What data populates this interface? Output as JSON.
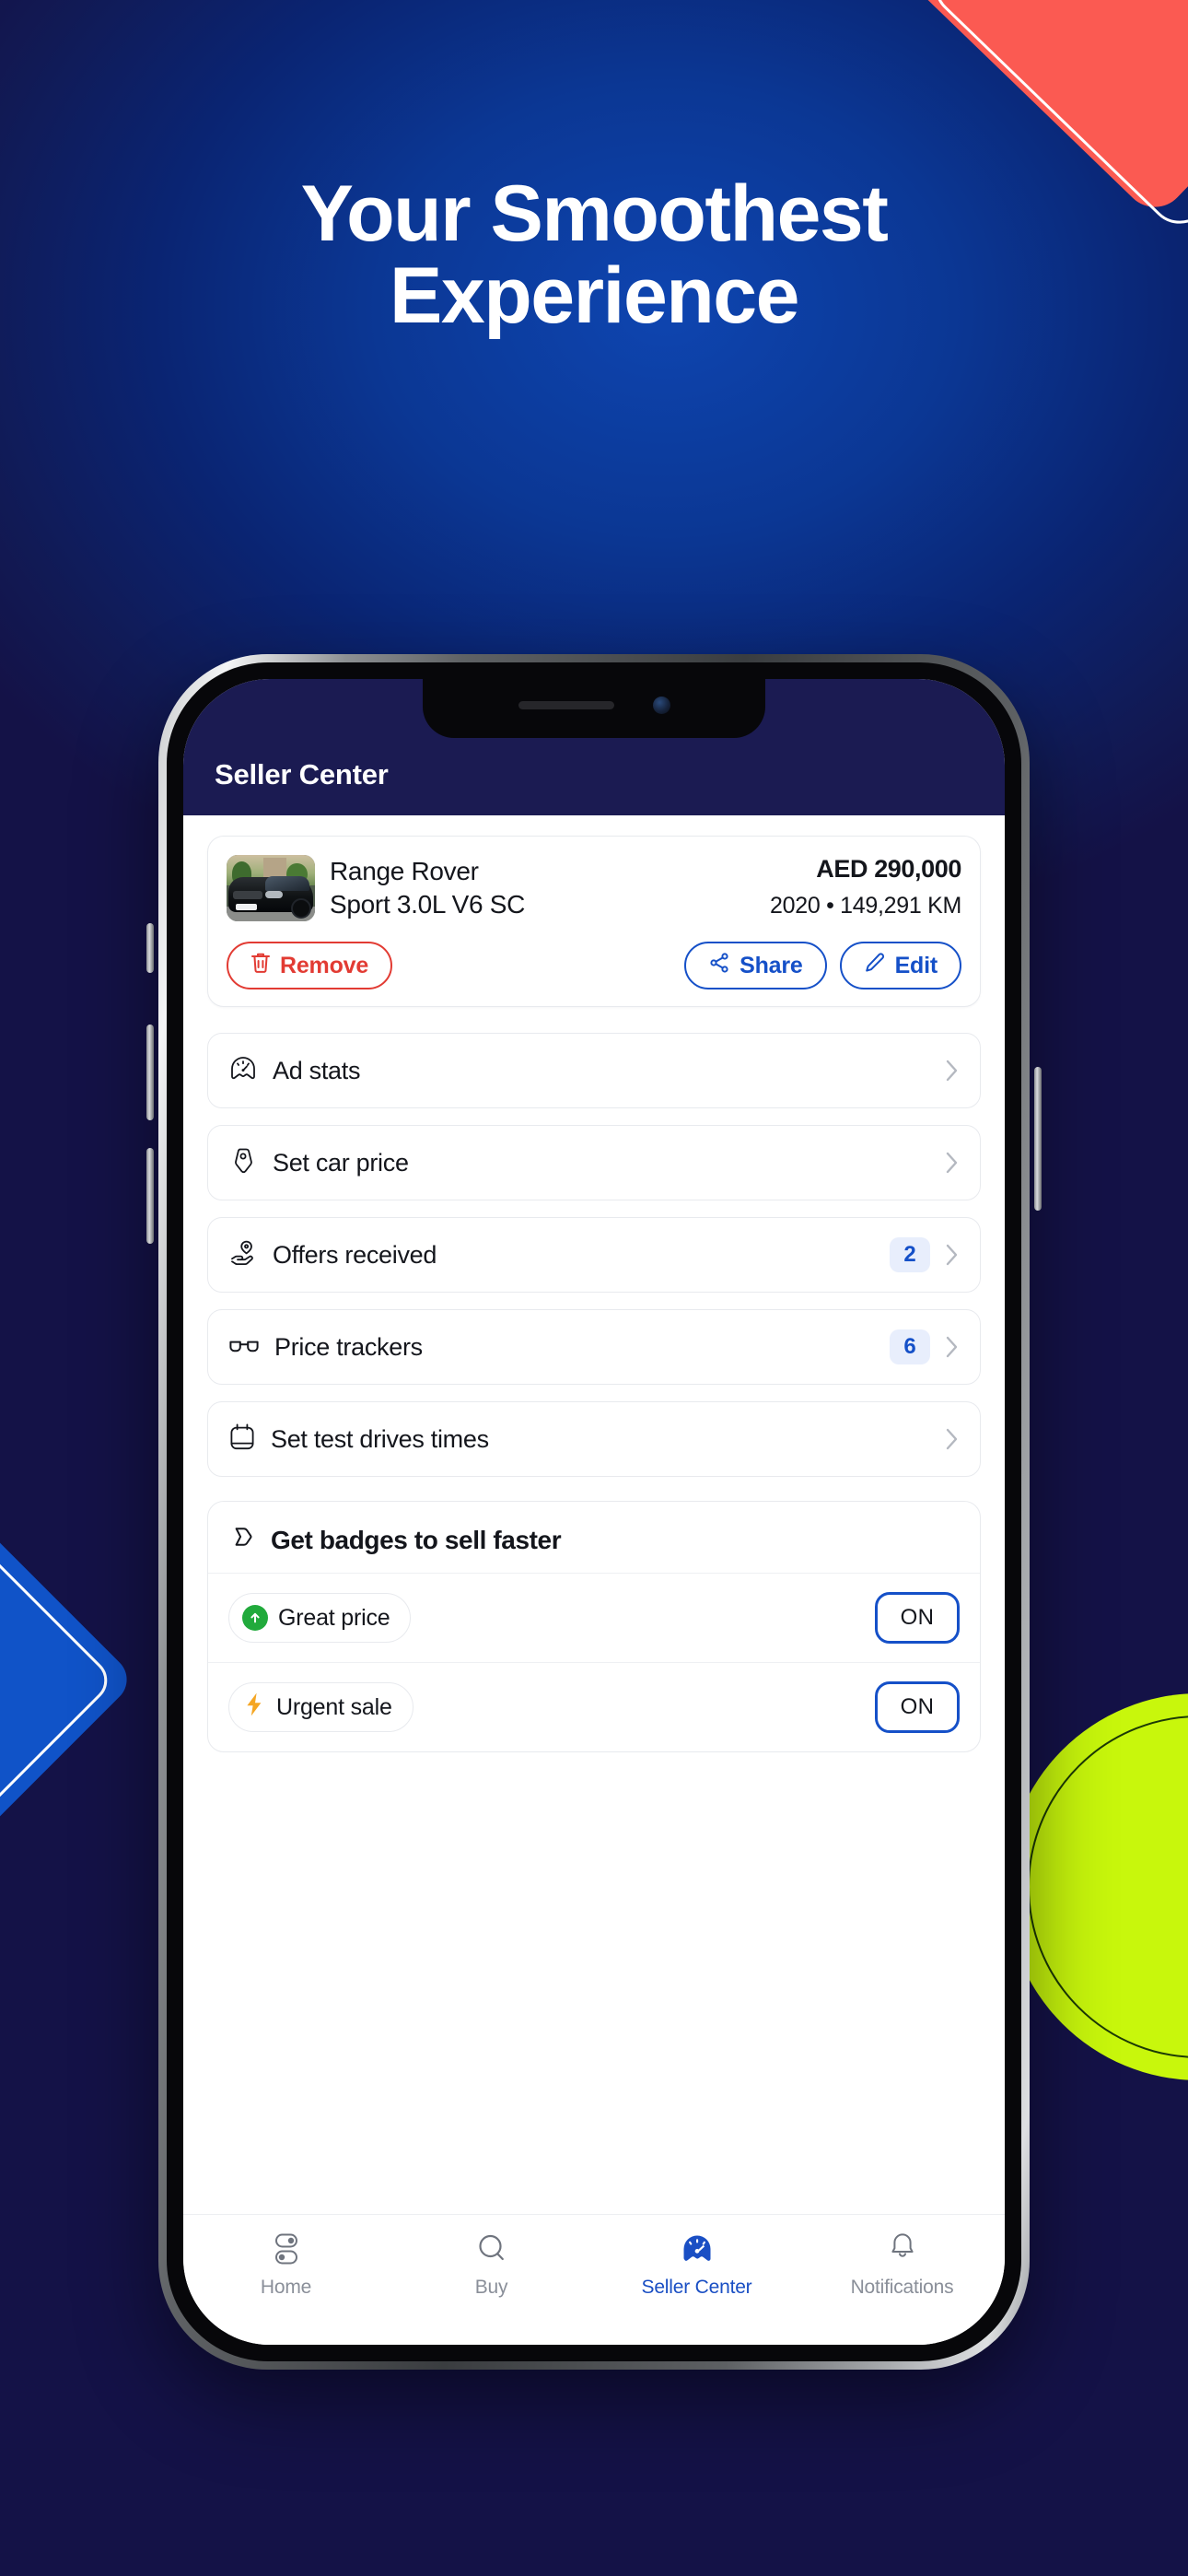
{
  "promo": {
    "headline_line1": "Your Smoothest",
    "headline_line2": "Experience",
    "background_color": "#0b2a72",
    "accent_red": "#fb5a52",
    "accent_blue": "#1053c8",
    "accent_lime": "#c8f70c"
  },
  "app": {
    "header": {
      "title": "Seller Center",
      "background_color": "#1b1b52"
    },
    "listing": {
      "thumbnail_alt": "black-range-rover-photo",
      "title_line1": "Range Rover",
      "title_line2": "Sport 3.0L V6 SC",
      "price": "AED 290,000",
      "meta": "2020 • 149,291 KM",
      "actions": [
        {
          "label": "Remove",
          "icon": "trash-icon",
          "color": "#e23b33"
        },
        {
          "label": "Share",
          "icon": "share-icon",
          "color": "#1550c8"
        },
        {
          "label": "Edit",
          "icon": "pencil-icon",
          "color": "#1550c8"
        }
      ]
    },
    "menu_items": [
      {
        "label": "Ad stats",
        "icon": "speedometer-icon",
        "badge": ""
      },
      {
        "label": "Set car price",
        "icon": "price-tag-icon",
        "badge": ""
      },
      {
        "label": "Offers received",
        "icon": "hand-offer-icon",
        "badge": "2"
      },
      {
        "label": "Price trackers",
        "icon": "glasses-icon",
        "badge": "6"
      },
      {
        "label": "Set test drives times",
        "icon": "calendar-icon",
        "badge": ""
      }
    ],
    "badges_section": {
      "title": "Get badges to sell faster",
      "icon": "badge-tag-icon",
      "rows": [
        {
          "label": "Great price",
          "icon": "green-arrow-up-icon",
          "toggle_label": "ON"
        },
        {
          "label": "Urgent sale",
          "icon": "lightning-bolt-icon",
          "toggle_label": "ON"
        }
      ]
    },
    "tabbar": {
      "active_color": "#1a4fc4",
      "inactive_color": "#8a8f99",
      "tabs": [
        {
          "label": "Home",
          "icon": "sliders-icon",
          "active": false
        },
        {
          "label": "Buy",
          "icon": "search-icon",
          "active": false
        },
        {
          "label": "Seller Center",
          "icon": "speedometer-filled-icon",
          "active": true
        },
        {
          "label": "Notifications",
          "icon": "bell-icon",
          "active": false
        }
      ]
    }
  }
}
